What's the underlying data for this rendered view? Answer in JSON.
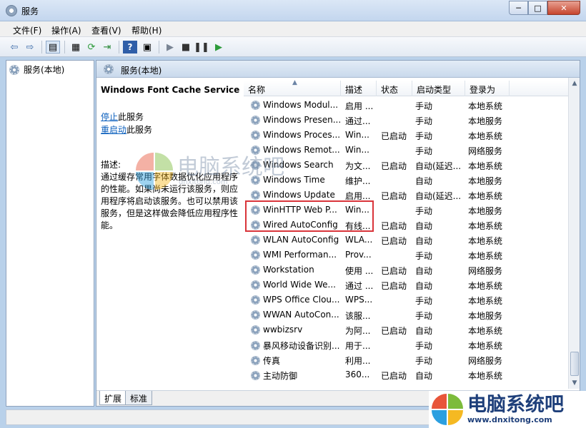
{
  "window": {
    "title": "服务",
    "buttons": {
      "minimize": "─",
      "maximize": "□",
      "close": "✕"
    }
  },
  "menu": [
    "文件(F)",
    "操作(A)",
    "查看(V)",
    "帮助(H)"
  ],
  "toolbar_icons": [
    "back-icon",
    "forward-icon",
    "console-tree-icon",
    "properties-icon",
    "refresh-icon",
    "export-icon",
    "help-icon",
    "help-topic-icon",
    "play-icon",
    "stop-icon",
    "pause-icon",
    "resume-icon"
  ],
  "tree": {
    "root_label": "服务(本地)"
  },
  "main": {
    "header_label": "服务(本地)",
    "service_name": "Windows Font Cache Service",
    "action_stop_link": "停止",
    "action_stop_suffix": "此服务",
    "action_restart_link": "重启动",
    "action_restart_suffix": "此服务",
    "description_label": "描述:",
    "description_text": "通过缓存常用字体数据优化应用程序的性能。如果尚未运行该服务，则应用程序将启动该服务。也可以禁用该服务，但是这样做会降低应用程序性能。"
  },
  "columns": {
    "name": "名称",
    "desc": "描述",
    "status": "状态",
    "startup": "启动类型",
    "logon": "登录为"
  },
  "services": [
    {
      "name": "Windows Modul...",
      "desc": "启用 ...",
      "status": "",
      "startup": "手动",
      "logon": "本地系统"
    },
    {
      "name": "Windows Presen...",
      "desc": "通过...",
      "status": "",
      "startup": "手动",
      "logon": "本地服务"
    },
    {
      "name": "Windows Proces...",
      "desc": "Win...",
      "status": "已启动",
      "startup": "手动",
      "logon": "本地系统"
    },
    {
      "name": "Windows Remot...",
      "desc": "Win...",
      "status": "",
      "startup": "手动",
      "logon": "网络服务"
    },
    {
      "name": "Windows Search",
      "desc": "为文...",
      "status": "已启动",
      "startup": "自动(延迟...",
      "logon": "本地系统"
    },
    {
      "name": "Windows Time",
      "desc": "维护...",
      "status": "",
      "startup": "自动",
      "logon": "本地服务"
    },
    {
      "name": "Windows Update",
      "desc": "启用...",
      "status": "已启动",
      "startup": "自动(延迟...",
      "logon": "本地系统"
    },
    {
      "name": "WinHTTP Web P...",
      "desc": "Win...",
      "status": "",
      "startup": "手动",
      "logon": "本地服务"
    },
    {
      "name": "Wired AutoConfig",
      "desc": "有线...",
      "status": "已启动",
      "startup": "自动",
      "logon": "本地系统"
    },
    {
      "name": "WLAN AutoConfig",
      "desc": "WLA...",
      "status": "已启动",
      "startup": "自动",
      "logon": "本地系统"
    },
    {
      "name": "WMI Performan...",
      "desc": "Prov...",
      "status": "",
      "startup": "手动",
      "logon": "本地系统"
    },
    {
      "name": "Workstation",
      "desc": "使用 ...",
      "status": "已启动",
      "startup": "自动",
      "logon": "网络服务"
    },
    {
      "name": "World Wide We...",
      "desc": "通过 ...",
      "status": "已启动",
      "startup": "自动",
      "logon": "本地系统"
    },
    {
      "name": "WPS Office Clou...",
      "desc": "WPS...",
      "status": "",
      "startup": "手动",
      "logon": "本地系统"
    },
    {
      "name": "WWAN AutoCon...",
      "desc": "该服...",
      "status": "",
      "startup": "手动",
      "logon": "本地服务"
    },
    {
      "name": "wwbizsrv",
      "desc": "为阿...",
      "status": "已启动",
      "startup": "自动",
      "logon": "本地系统"
    },
    {
      "name": "暴风移动设备识别...",
      "desc": "用于...",
      "status": "",
      "startup": "手动",
      "logon": "本地系统"
    },
    {
      "name": "传真",
      "desc": "利用...",
      "status": "",
      "startup": "手动",
      "logon": "网络服务"
    },
    {
      "name": "主动防御",
      "desc": "360...",
      "status": "已启动",
      "startup": "自动",
      "logon": "本地系统"
    }
  ],
  "tabs": [
    "扩展",
    "标准"
  ],
  "watermark": {
    "cn": "电脑系统吧",
    "url": "www.dnxitong.com",
    "center_cn": "电脑系统吧",
    "center_url": "dnxitong.com"
  },
  "colors": {
    "link": "#0b5fbd",
    "highlight": "#d9343a",
    "selection": "#d9e6f5"
  }
}
